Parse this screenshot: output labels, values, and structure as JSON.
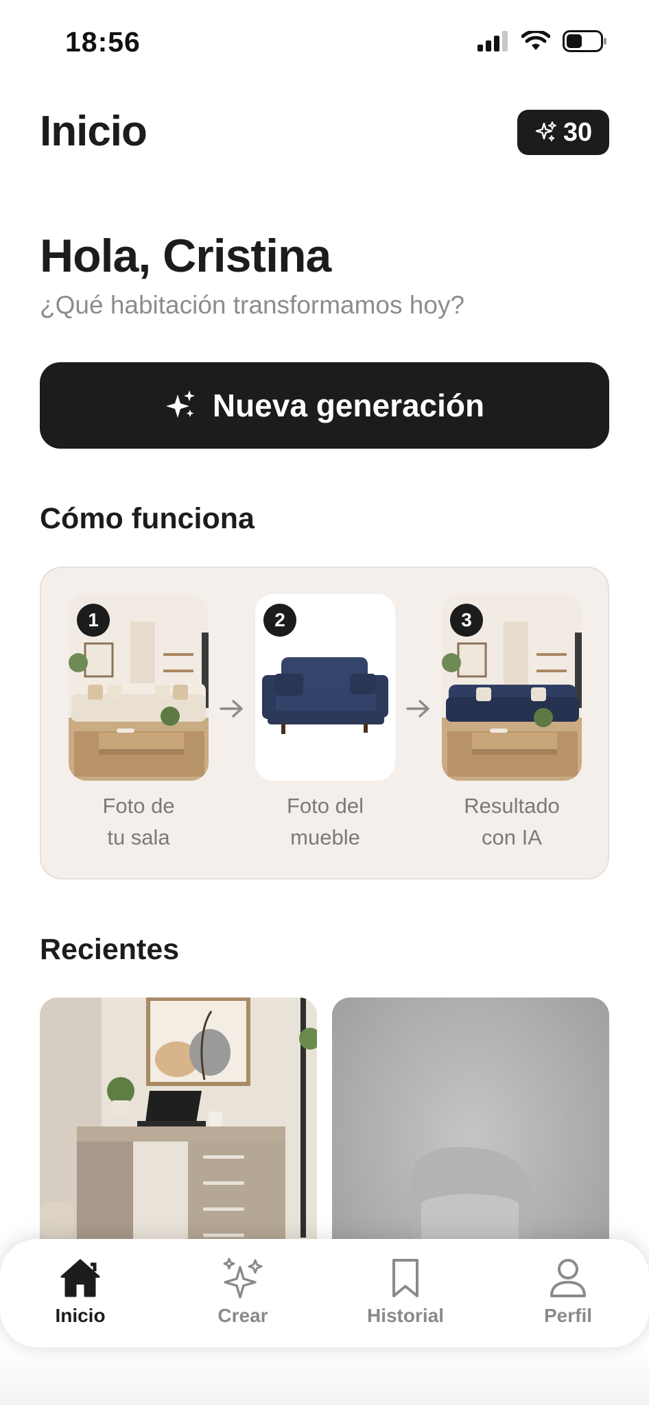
{
  "status_bar": {
    "time": "18:56"
  },
  "header": {
    "title": "Inicio",
    "credits": "30"
  },
  "greeting": {
    "title": "Hola, Cristina",
    "subtitle": "¿Qué habitación transformamos hoy?"
  },
  "new_generation": {
    "label": "Nueva generación"
  },
  "how_it_works": {
    "title": "Cómo funciona",
    "steps": [
      {
        "number": "1",
        "label_line1": "Foto de",
        "label_line2": "tu sala"
      },
      {
        "number": "2",
        "label_line1": "Foto del",
        "label_line2": "mueble"
      },
      {
        "number": "3",
        "label_line1": "Resultado",
        "label_line2": "con IA"
      }
    ]
  },
  "recents": {
    "title": "Recientes"
  },
  "tab_bar": {
    "items": [
      {
        "label": "Inicio",
        "icon": "home-icon",
        "active": true
      },
      {
        "label": "Crear",
        "icon": "sparkles-icon",
        "active": false
      },
      {
        "label": "Historial",
        "icon": "bookmark-icon",
        "active": false
      },
      {
        "label": "Perfil",
        "icon": "person-icon",
        "active": false
      }
    ]
  },
  "colors": {
    "primary": "#1c1c1c",
    "card_bg": "#f4efeb",
    "muted_text": "#8c8c8c",
    "sofa_navy": "#2d3a5c"
  }
}
